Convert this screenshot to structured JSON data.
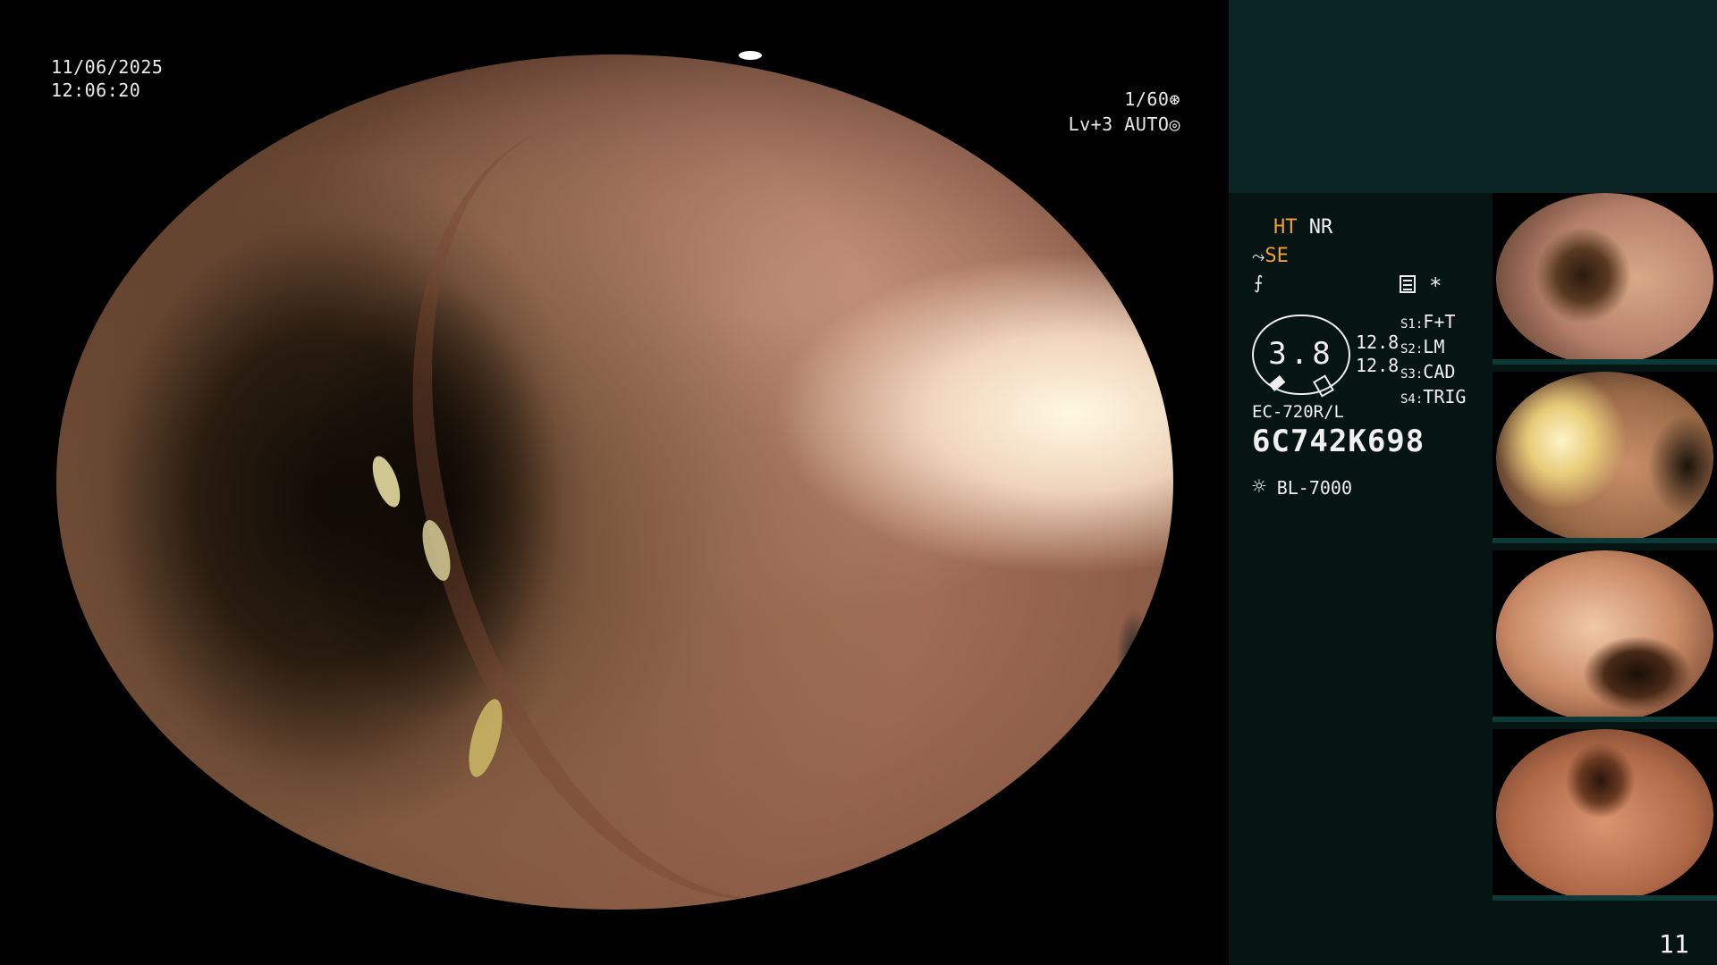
{
  "datetime": {
    "date": "11/06/2025",
    "time": "12:06:20"
  },
  "camera": {
    "shutter": "1/60",
    "level": "Lv+3",
    "mode": "AUTO",
    "shutter_icon": "aperture-icon",
    "mode_icon": "iris-icon"
  },
  "processing": {
    "ht": "HT",
    "nr": "NR",
    "se": "SE",
    "se_icon": "se-mode-icon",
    "flash_icon": "enhancement-icon",
    "settings_icon": "menu-icon",
    "asterisk": "*"
  },
  "zoom": {
    "value": "3.8",
    "right_top": "12.8",
    "right_bottom": "12.8"
  },
  "switches": [
    {
      "key": "S1",
      "value": "F+T"
    },
    {
      "key": "S2",
      "value": "LM"
    },
    {
      "key": "S3",
      "value": "CAD"
    },
    {
      "key": "S4",
      "value": "TRIG"
    }
  ],
  "scope": {
    "model": "EC-720R/L",
    "serial": "6C742K698"
  },
  "light_source": {
    "icon": "lamp-icon",
    "model": "BL-7000"
  },
  "page_number": "11",
  "colors": {
    "panel_top": "#0b2424",
    "panel_bottom": "#061413",
    "accent": "#f0a030"
  }
}
